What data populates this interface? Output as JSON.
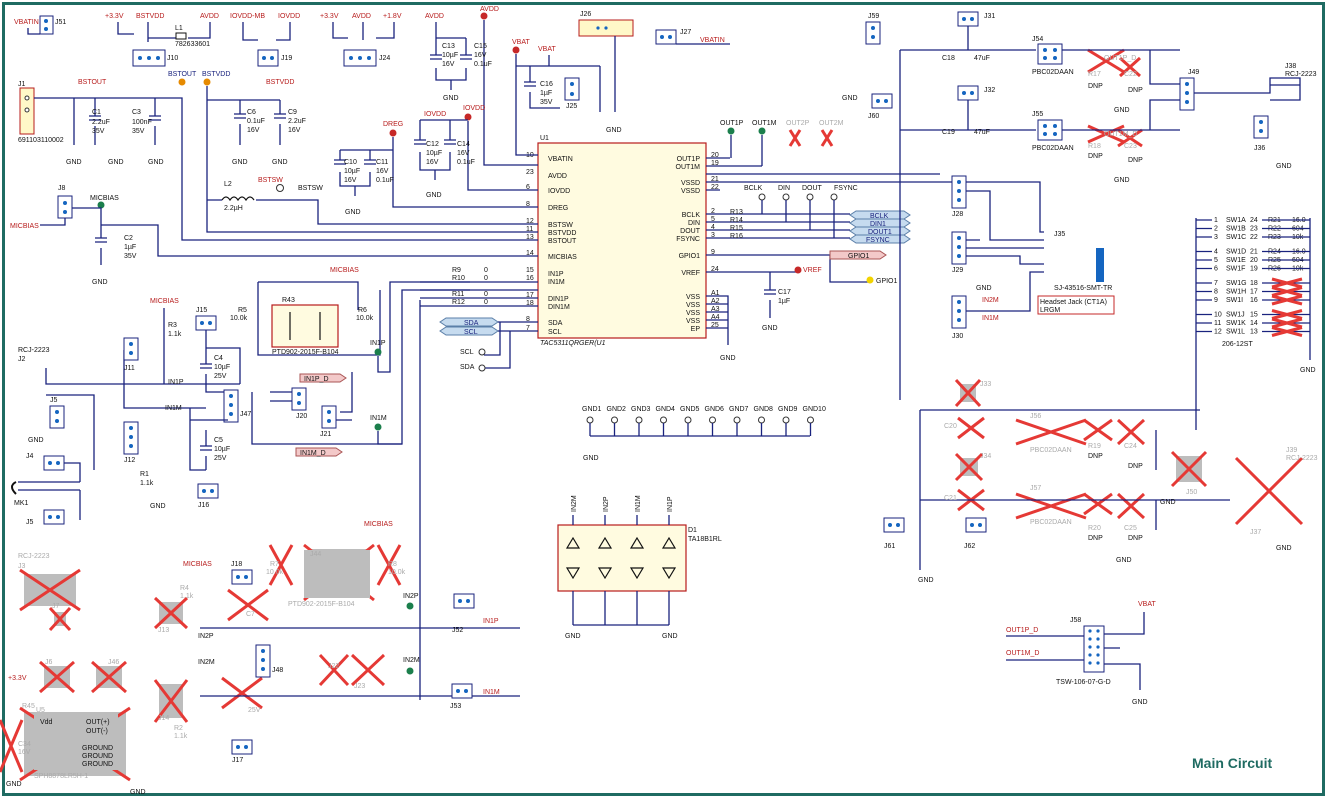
{
  "title": "Main Circuit",
  "u1": {
    "ref": "U1",
    "part": "TAC5311QRGER(U1",
    "pins_left": [
      {
        "n": "10",
        "name": "VBATIN"
      },
      {
        "n": "23",
        "name": "AVDD"
      },
      {
        "n": "6",
        "name": "IOVDD"
      },
      {
        "n": "8",
        "name": "DREG"
      },
      {
        "n": "12",
        "name": "BSTSW"
      },
      {
        "n": "11",
        "name": "BSTVDD"
      },
      {
        "n": "13",
        "name": "BSTOUT"
      },
      {
        "n": "14",
        "name": "MICBIAS"
      },
      {
        "n": "15",
        "name": "IN1P"
      },
      {
        "n": "16",
        "name": "IN1M"
      },
      {
        "n": "17",
        "name": "DIN1P"
      },
      {
        "n": "18",
        "name": "DIN1M"
      },
      {
        "n": "8",
        "name": "SDA"
      },
      {
        "n": "7",
        "name": "SCL"
      }
    ],
    "pins_right": [
      {
        "n": "20",
        "name": "OUT1P"
      },
      {
        "n": "19",
        "name": "OUT1M"
      },
      {
        "n": "21",
        "name": "VSSD"
      },
      {
        "n": "22",
        "name": "VSSD"
      },
      {
        "n": "2",
        "name": "BCLK"
      },
      {
        "n": "5",
        "name": "DIN"
      },
      {
        "n": "4",
        "name": "DOUT"
      },
      {
        "n": "3",
        "name": "FSYNC"
      },
      {
        "n": "9",
        "name": "GPIO1"
      },
      {
        "n": "24",
        "name": "VREF"
      },
      {
        "n": "A1",
        "name": "VSS"
      },
      {
        "n": "A2",
        "name": "VSS"
      },
      {
        "n": "A3",
        "name": "VSS"
      },
      {
        "n": "A4",
        "name": "VSS"
      },
      {
        "n": "25",
        "name": "EP"
      }
    ]
  },
  "nets": {
    "vbatin": "VBATIN",
    "v33a": "+3.3V",
    "bstvdd": "BSTVDD",
    "avdd": "AVDD",
    "iovdd_mb": "IOVDD-MB",
    "iovdd": "IOVDD",
    "v33b": "+3.3V",
    "avdd2": "AVDD",
    "v18": "+1.8V",
    "avdd3": "AVDD",
    "vbat": "VBAT",
    "vbatin2": "VBATIN",
    "bstout": "BSTOUT",
    "bstout2": "BSTOUT",
    "bstvdd2": "BSTVDD",
    "bstvdd3": "BSTVDD",
    "dreg": "DREG",
    "iovdd2": "IOVDD",
    "avdd4": "AVDD",
    "bstsw": "BSTSW",
    "bstsw2": "BSTSW",
    "micbias": "MICBIAS",
    "micbias2": "MICBIAS",
    "micbias3": "MICBIAS",
    "micbias4": "MICBIAS",
    "micbias5": "MICBIAS",
    "micbias6": "MICBIAS",
    "in1p": "IN1P",
    "in1m": "IN1M",
    "in1p2": "IN1P",
    "in1m2": "IN1M",
    "in2p": "IN2P",
    "in2m": "IN2M",
    "in2p2": "IN2P",
    "in2m2": "IN2M",
    "out1p": "OUT1P",
    "out1m": "OUT1M",
    "out2p": "OUT2P",
    "out2m": "OUT2M",
    "vref": "VREF",
    "scl": "SCL",
    "sda": "SDA",
    "bclk": "BCLK",
    "din": "DIN",
    "dout": "DOUT",
    "fsync": "FSYNC",
    "vbat2": "VBAT",
    "v33c": "+3.3V",
    "in1p_d": "IN1P_D",
    "in1m_d": "IN1M_D",
    "in2m3": "IN2M",
    "in1m3": "IN1M",
    "out1p_d": "OUT1P_D",
    "out1m_d": "OUT1M_D",
    "out1p_d2": "OUT1P_D",
    "out1m_d2": "OUT1M_D",
    "in2p3": "IN2P",
    "in1p3": "IN1P"
  },
  "flags": {
    "bclk": "BCLK",
    "din1": "DIN1",
    "dout1": "DOUT1",
    "fsync": "FSYNC",
    "gpio1": "GPIO1",
    "gpio1b": "GPIO1",
    "sda": "SDA",
    "scl": "SCL",
    "in1p_d": "IN1P_D",
    "in1m_d": "IN1M_D"
  },
  "components": {
    "j51": "J51",
    "j1": "J1",
    "j1_part": "691103110002",
    "j10": "J10",
    "l1": "L1",
    "l1_part": "782633601",
    "j19": "J19",
    "j24": "J24",
    "c13": "C13",
    "c13v": "10µF",
    "c13r": "16V",
    "c15": "C15",
    "c15v": "16V",
    "c15r": "0.1uF",
    "c1": "C1",
    "c1v": "2.2uF",
    "c1r": "35V",
    "c3": "C3",
    "c3v": "100nF",
    "c3r": "35V",
    "c6": "C6",
    "c6v": "0.1uF",
    "c6r": "16V",
    "c9": "C9",
    "c9v": "2.2uF",
    "c9r": "16V",
    "c16": "C16",
    "c16v": "1µF",
    "c16r": "35V",
    "j25": "J25",
    "j26": "J26",
    "j27": "J27",
    "c10": "C10",
    "c10v": "10µF",
    "c10r": "16V",
    "c11": "C11",
    "c11v": "16V",
    "c11r": "0.1uF",
    "c12": "C12",
    "c12v": "10µF",
    "c12r": "16V",
    "c14": "C14",
    "c14v": "16V",
    "c14r": "0.1uF",
    "l2": "L2",
    "l2v": "2.2µH",
    "j8": "J8",
    "c2": "C2",
    "c2v": "1µF",
    "c2r": "35V",
    "r43": "R43",
    "r43_part": "PTD902-2015F-B104",
    "r5": "R5",
    "r5v": "10.0k",
    "r6": "R6",
    "r6v": "10.0k",
    "j15": "J15",
    "r3": "R3",
    "r3v": "1.1k",
    "j2": "J2",
    "j2_part": "RCJ-2223",
    "j11": "J11",
    "c4": "C4",
    "c4v": "10µF",
    "c4r": "25V",
    "j47": "J47",
    "j20": "J20",
    "j21": "J21",
    "c5": "C5",
    "c5v": "10µF",
    "c5r": "25V",
    "j12": "J12",
    "r1": "R1",
    "r1v": "1.1k",
    "j16": "J16",
    "j5": "J5",
    "j4": "J4",
    "mk1": "MK1",
    "j5b": "J5",
    "r9": "R9",
    "r10": "R10",
    "r11": "R11",
    "r12": "R12",
    "r0": "0",
    "r13": "R13",
    "r14": "R14",
    "r15": "R15",
    "r16": "R16",
    "c17": "C17",
    "c17v": "1µF",
    "gnds": [
      "GND1",
      "GND2",
      "GND3",
      "GND4",
      "GND5",
      "GND6",
      "GND7",
      "GND8",
      "GND9",
      "GND10"
    ],
    "d1": "D1",
    "d1_part": "TA18B1RL",
    "d1_pins": [
      "IN2M",
      "IN2P",
      "IN1M",
      "IN1P"
    ],
    "j59": "J59",
    "j60": "J60",
    "j31": "J31",
    "j32": "J32",
    "c18": "C18",
    "c18v": "47uF",
    "c19": "C19",
    "c19v": "47uF",
    "j54": "J54",
    "j54_part": "PBC02DAAN",
    "j55": "J55",
    "j55_part": "PBC02DAAN",
    "r17": "R17",
    "r18": "R18",
    "c22": "C22",
    "c23": "C23",
    "c22v": "47nF",
    "dnp": "DNP",
    "r00": "100",
    "j49": "J49",
    "j38": "J38",
    "j38_part": "RCJ-2223",
    "j36": "J36",
    "j28": "J28",
    "j29": "J29",
    "j30": "J30",
    "j35": "J35",
    "j35_part": "SJ-43516-SMT-TR",
    "hp_note": "Headset Jack (CT1A)",
    "hp_note2": "LRGM",
    "sw1a": "SW1A",
    "sw1b": "SW1B",
    "sw1c": "SW1C",
    "sw1d": "SW1D",
    "sw1e": "SW1E",
    "sw1f": "SW1F",
    "sw1g": "SW1G",
    "sw1h": "SW1H",
    "sw1i": "SW1I",
    "sw1j": "SW1J",
    "sw1k": "SW1K",
    "sw1l": "SW1L",
    "r21": "R21",
    "r22": "R22",
    "r23": "R23",
    "r24": "R24",
    "r25": "R25",
    "r26": "R26",
    "r21v": "16.0",
    "r22v": "604",
    "r23v": "10k",
    "sw_part": "206-12ST",
    "j33": "J33",
    "j34": "J34",
    "j56": "J56",
    "j56_part": "PBC02DAAN",
    "j57": "J57",
    "j57_part": "PBC02DAAN",
    "r19": "R19",
    "r20": "R20",
    "c24": "C24",
    "c25": "C25",
    "j50": "J50",
    "j39": "J39",
    "j39_part": "RCJ-2223",
    "j37": "J37",
    "j61": "J61",
    "j62": "J62",
    "c20": "C20",
    "c21": "C21",
    "j58": "J58",
    "j58_part": "TSW-106-07-G-D",
    "j3": "J3",
    "j3_part": "RCJ-2223",
    "j7": "J7",
    "j13": "J13",
    "r4": "R4",
    "r4v": "1.1k",
    "j18": "J18",
    "r7": "R7",
    "r7v": "10.0k",
    "j44": "J44",
    "j44_part": "PTD902-2015F-B104",
    "r8": "R8",
    "r8v": "10.0k",
    "c7": "C7",
    "j48": "J48",
    "j22": "J22",
    "j23": "J23",
    "j52": "J52",
    "j53": "J53",
    "j6": "J6",
    "j46": "J46",
    "j14": "J14",
    "r2": "R2",
    "r2v": "1.1k",
    "c8": "C8",
    "c8r": "25V",
    "j17": "J17",
    "r45": "R45",
    "u5": "U5",
    "u5_part": "SPH8878LR5H-1",
    "c34": "C34",
    "c34r": "16V",
    "u5_pins": [
      "Vdd",
      "OUT(+)",
      "OUT(-)",
      "GROUND",
      "GROUND",
      "GROUND"
    ]
  },
  "gnd": "GND"
}
